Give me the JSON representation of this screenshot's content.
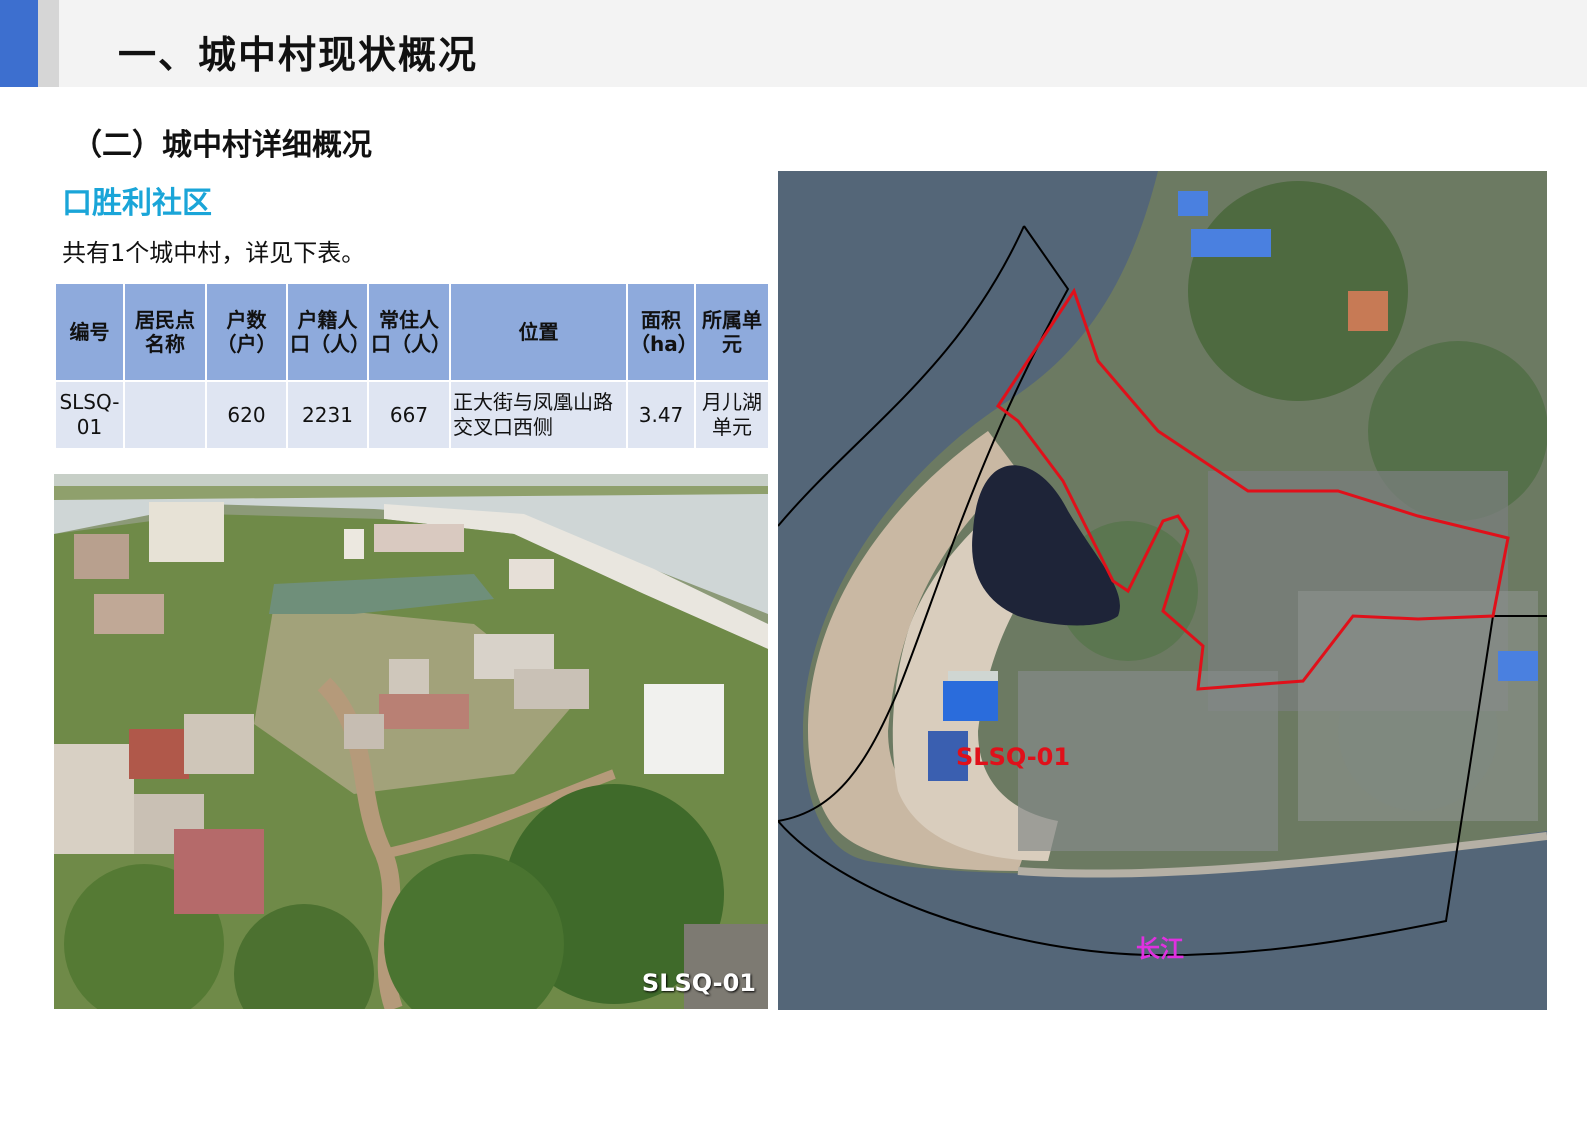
{
  "header": {
    "title": "一、城中村现状概况"
  },
  "section": {
    "title": "（二）城中村详细概况"
  },
  "community": {
    "title": "口胜利社区",
    "intro": "共有1个城中村，详见下表。"
  },
  "table": {
    "headers": [
      "编号",
      "居民点名称",
      "户数（户）",
      "户籍人口（人）",
      "常住人口（人）",
      "位置",
      "面积（ha）",
      "所属单元"
    ],
    "rows": [
      {
        "code": "SLSQ-01",
        "name": "",
        "households": "620",
        "registered": "2231",
        "resident": "667",
        "location": "正大街与凤凰山路交叉口西侧",
        "area": "3.47",
        "unit": "月儿湖单元"
      }
    ]
  },
  "photo": {
    "label": "SLSQ-01"
  },
  "map": {
    "code_label": "SLSQ-01",
    "river_label": "长江"
  },
  "colors": {
    "accent": "#3d6fcf",
    "community_title": "#1aa5d8",
    "table_header": "#8eaadc",
    "table_row": "#dfe5f2",
    "boundary_red": "#e0101a",
    "river_label": "#e030e0"
  }
}
